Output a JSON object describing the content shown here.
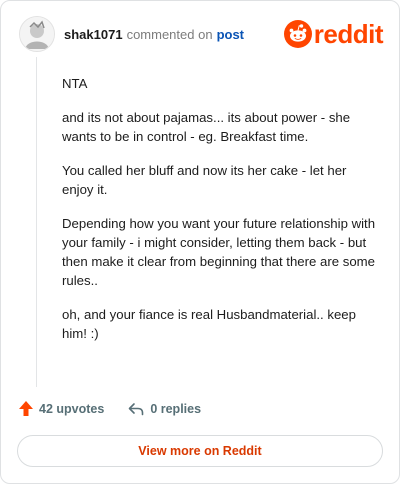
{
  "comment": {
    "username": "shak1071",
    "action_text": "commented on",
    "post_link": "post",
    "paragraphs": [
      "NTA",
      "and its not about pajamas... its about power - she wants to be in control - eg. Breakfast time.",
      "You called her bluff and now its her cake - let her enjoy it.",
      "Depending how you want your future relationship with your family - i might consider, letting them back - but then make it clear from beginning that there are some rules..",
      "oh, and your fiance is real Husbandmaterial.. keep him! :)"
    ]
  },
  "brand": {
    "name": "reddit",
    "color": "#ff4500"
  },
  "actions": {
    "upvotes_label": "42 upvotes",
    "replies_label": "0 replies"
  },
  "footer": {
    "view_more_label": "View more on Reddit"
  },
  "icons": {
    "avatar": "avatar-icon",
    "logo": "reddit-snoo-icon",
    "upvote": "upvote-arrow-icon",
    "reply": "reply-arrow-icon"
  },
  "colors": {
    "accent": "#ff4500",
    "link": "#0a54b5",
    "muted": "#576f76"
  }
}
